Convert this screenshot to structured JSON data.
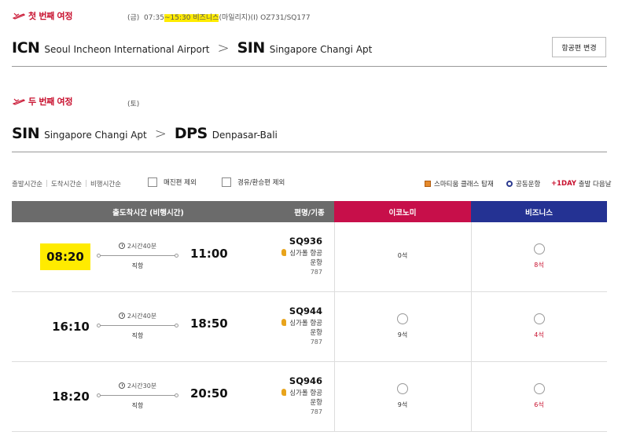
{
  "trip1": {
    "title": "첫 번째 여정",
    "day": "(금)",
    "time_pre": "07:35",
    "time_hl": "~15:30 비즈니스",
    "time_post": "(마일리지)(I) OZ731/SQ177",
    "origin_code": "ICN",
    "origin_name": "Seoul Incheon International Airport",
    "dest_code": "SIN",
    "dest_name": "Singapore Changi Apt",
    "change_button": "항공편 변경"
  },
  "trip2": {
    "title": "두 번째 여정",
    "day": "(토)",
    "origin_code": "SIN",
    "origin_name": "Singapore Changi Apt",
    "dest_code": "DPS",
    "dest_name": "Denpasar-Bali"
  },
  "route_arrow": ">",
  "sort": {
    "items": [
      "출발시간순",
      "도착시간순",
      "비행시간순"
    ]
  },
  "filters": {
    "sold_out": "매진편 제외",
    "transit": "경유/환승편 제외"
  },
  "legend": {
    "smartium": "스마티움 클래스 탑재",
    "codeshare": "공동운항",
    "plus_day": "+1DAY",
    "plus_day_desc": "출발 다음날"
  },
  "table_header": {
    "time": "출도착시간 (비행시간)",
    "flight": "편명/기종",
    "economy": "이코노미",
    "business": "비즈니스"
  },
  "flights": [
    {
      "dep": "08:20",
      "arr": "11:00",
      "duration": "2시간40분",
      "type": "직항",
      "flight_no": "SQ936",
      "airline": "싱가폴 항공",
      "operated": "운항",
      "aircraft": "787",
      "economy": "0석",
      "business": "8석"
    },
    {
      "dep": "16:10",
      "arr": "18:50",
      "duration": "2시간40분",
      "type": "직항",
      "flight_no": "SQ944",
      "airline": "싱가폴 항공",
      "operated": "운항",
      "aircraft": "787",
      "economy": "9석",
      "business": "4석"
    },
    {
      "dep": "18:20",
      "arr": "20:50",
      "duration": "2시간30분",
      "type": "직항",
      "flight_no": "SQ946",
      "airline": "싱가폴 항공",
      "operated": "운항",
      "aircraft": "787",
      "economy": "9석",
      "business": "6석"
    }
  ],
  "colors": {
    "brand_red": "#c8102e",
    "economy": "#c70f4a",
    "business": "#243293",
    "highlight": "#ffeb00"
  }
}
